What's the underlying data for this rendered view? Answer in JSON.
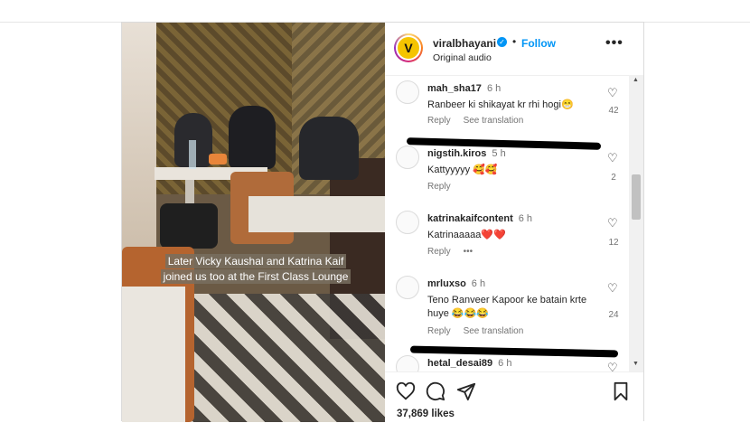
{
  "post": {
    "username": "viralbhayani",
    "verified_icon": "verified-badge-icon",
    "separator": "•",
    "follow_label": "Follow",
    "audio_label": "Original audio",
    "avatar_letter": "V",
    "more_icon": "more-options-icon",
    "media_caption": "Later Vicky Kaushal and Katrina Kaif joined us too at the First Class Lounge"
  },
  "comments": [
    {
      "user": "mah_sha17",
      "time": "6 h",
      "text": "Ranbeer ki shikayat kr rhi hogi😁",
      "reply": "Reply",
      "see_translation": "See translation",
      "likes": "42"
    },
    {
      "user": "nigstih.kiros",
      "time": "5 h",
      "text": "Kattyyyyy 🥰🥰",
      "reply": "Reply",
      "see_translation": "",
      "likes": "2"
    },
    {
      "user": "katrinakaifcontent",
      "time": "6 h",
      "text": "Katrinaaaaa❤️❤️",
      "reply": "Reply",
      "see_translation": "•••",
      "likes": "12"
    },
    {
      "user": "mrluxso",
      "time": "6 h",
      "text": "Teno Ranveer Kapoor ke batain krte huye 😂😂😂",
      "reply": "Reply",
      "see_translation": "See translation",
      "likes": "24"
    },
    {
      "user": "hetal_desai89",
      "time": "6 h",
      "text": "",
      "reply": "",
      "see_translation": "",
      "likes": ""
    }
  ],
  "actions": {
    "like_icon": "heart-icon",
    "comment_icon": "comment-icon",
    "share_icon": "share-icon",
    "save_icon": "bookmark-icon",
    "likes_text": "37,869 likes"
  },
  "colors": {
    "accent": "#0095f6",
    "text": "#262626",
    "muted": "#737373"
  }
}
